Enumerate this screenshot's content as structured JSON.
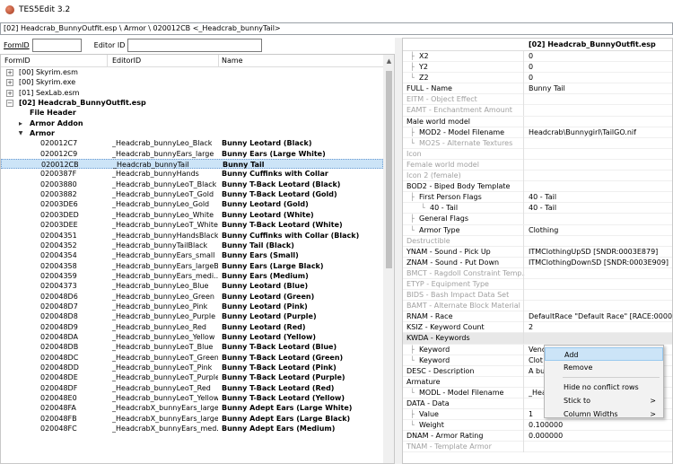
{
  "window": {
    "title": "TES5Edit 3.2"
  },
  "path": "[02] Headcrab_BunnyOutfit.esp \\ Armor \\ 020012CB <_Headcrab_bunnyTail>",
  "filter": {
    "formid_label": "FormID",
    "editorid_label": "Editor ID"
  },
  "left": {
    "columns": [
      "FormID",
      "EditorID",
      "Name"
    ],
    "top": [
      {
        "label": "[00] Skyrim.esm",
        "exp": "+"
      },
      {
        "label": "[00] Skyrim.exe",
        "exp": "+"
      },
      {
        "label": "[01] SexLab.esm",
        "exp": "+"
      },
      {
        "label": "[02] Headcrab_BunnyOutfit.esp",
        "exp": "-"
      },
      {
        "label": "File Header",
        "exp": ""
      },
      {
        "label": "Armor Addon",
        "exp": "+"
      },
      {
        "label": "Armor",
        "exp": "-"
      }
    ],
    "rows": [
      [
        "020012C7",
        "_Headcrab_bunnyLeo_Black",
        "Bunny Leotard (Black)"
      ],
      [
        "020012C9",
        "_Headcrab_bunnyEars_large",
        "Bunny Ears (Large White)"
      ],
      [
        "020012CB",
        "_Headcrab_bunnyTail",
        "Bunny Tail"
      ],
      [
        "0200387F",
        "_Headcrab_bunnyHands",
        "Bunny Cuffinks with Collar"
      ],
      [
        "02003880",
        "_Headcrab_bunnyLeoT_Black",
        "Bunny T-Back Leotard (Black)"
      ],
      [
        "02003882",
        "_Headcrab_bunnyLeoT_Gold",
        "Bunny T-Back Leotard (Gold)"
      ],
      [
        "02003DE6",
        "_Headcrab_bunnyLeo_Gold",
        "Bunny Leotard (Gold)"
      ],
      [
        "02003DED",
        "_Headcrab_bunnyLeo_White",
        "Bunny Leotard (White)"
      ],
      [
        "02003DEE",
        "_Headcrab_bunnyLeoT_White",
        "Bunny T-Back Leotard (White)"
      ],
      [
        "02004351",
        "_Headcrab_bunnyHandsBlack",
        "Bunny Cuffinks with Collar (Black)"
      ],
      [
        "02004352",
        "_Headcrab_bunnyTailBlack",
        "Bunny Tail (Black)"
      ],
      [
        "02004354",
        "_Headcrab_bunnyEars_small",
        "Bunny Ears (Small)"
      ],
      [
        "02004358",
        "_Headcrab_bunnyEars_largeB",
        "Bunny Ears (Large Black)"
      ],
      [
        "02004359",
        "_Headcrab_bunnyEars_medi...",
        "Bunny Ears (Medium)"
      ],
      [
        "02004373",
        "_Headcrab_bunnyLeo_Blue",
        "Bunny Leotard (Blue)"
      ],
      [
        "020048D6",
        "_Headcrab_bunnyLeo_Green",
        "Bunny Leotard (Green)"
      ],
      [
        "020048D7",
        "_Headcrab_bunnyLeo_Pink",
        "Bunny Leotard (Pink)"
      ],
      [
        "020048D8",
        "_Headcrab_bunnyLeo_Purple",
        "Bunny Leotard (Purple)"
      ],
      [
        "020048D9",
        "_Headcrab_bunnyLeo_Red",
        "Bunny Leotard (Red)"
      ],
      [
        "020048DA",
        "_Headcrab_bunnyLeo_Yellow",
        "Bunny Leotard (Yellow)"
      ],
      [
        "020048DB",
        "_Headcrab_bunnyLeoT_Blue",
        "Bunny T-Back Leotard (Blue)"
      ],
      [
        "020048DC",
        "_Headcrab_bunnyLeoT_Green",
        "Bunny T-Back Leotard (Green)"
      ],
      [
        "020048DD",
        "_Headcrab_bunnyLeoT_Pink",
        "Bunny T-Back Leotard (Pink)"
      ],
      [
        "020048DE",
        "_Headcrab_bunnyLeoT_Purple",
        "Bunny T-Back Leotard (Purple)"
      ],
      [
        "020048DF",
        "_Headcrab_bunnyLeoT_Red",
        "Bunny T-Back Leotard (Red)"
      ],
      [
        "020048E0",
        "_Headcrab_bunnyLeoT_Yellow",
        "Bunny T-Back Leotard (Yellow)"
      ],
      [
        "020048FA",
        "_HeadcrabX_bunnyEars_large",
        "Bunny Adept Ears (Large White)"
      ],
      [
        "020048FB",
        "_HeadcrabX_bunnyEars_large",
        "Bunny Adept Ears (Large Black)"
      ],
      [
        "020048FC",
        "_HeadcrabX_bunnyEars_med...",
        "Bunny Adept Ears (Medium)"
      ]
    ]
  },
  "right": {
    "header": "[02] Headcrab_BunnyOutfit.esp",
    "rows": [
      {
        "k": "X2",
        "v": "0",
        "ind": 18,
        "g": "├"
      },
      {
        "k": "Y2",
        "v": "0",
        "ind": 18,
        "g": "├"
      },
      {
        "k": "Z2",
        "v": "0",
        "ind": 18,
        "g": "└"
      },
      {
        "k": "FULL - Name",
        "v": "Bunny Tail",
        "ind": 4
      },
      {
        "k": "EITM - Object Effect",
        "v": "",
        "ind": 4,
        "gray": true
      },
      {
        "k": "EAMT - Enchantment Amount",
        "v": "",
        "ind": 4,
        "gray": true
      },
      {
        "k": "Male world model",
        "v": "",
        "ind": 4
      },
      {
        "k": "MOD2 - Model Filename",
        "v": "Headcrab\\Bunnygirl\\TailGO.nif",
        "ind": 18,
        "g": "├"
      },
      {
        "k": "MO2S - Alternate Textures",
        "v": "",
        "ind": 18,
        "g": "└",
        "gray": true
      },
      {
        "k": "Icon",
        "v": "",
        "ind": 4,
        "gray": true
      },
      {
        "k": "Female world model",
        "v": "",
        "ind": 4,
        "gray": true
      },
      {
        "k": "Icon 2 (female)",
        "v": "",
        "ind": 4,
        "gray": true
      },
      {
        "k": "BOD2 - Biped Body Template",
        "v": "",
        "ind": 4
      },
      {
        "k": "First Person Flags",
        "v": "40 - Tail",
        "ind": 18,
        "g": "├"
      },
      {
        "k": "40 - Tail",
        "v": "40 - Tail",
        "ind": 30,
        "g": "└"
      },
      {
        "k": "General Flags",
        "v": "",
        "ind": 18,
        "g": "├"
      },
      {
        "k": "Armor Type",
        "v": "Clothing",
        "ind": 18,
        "g": "└"
      },
      {
        "k": "Destructible",
        "v": "",
        "ind": 4,
        "gray": true
      },
      {
        "k": "YNAM - Sound - Pick Up",
        "v": "ITMClothingUpSD [SNDR:0003E879]",
        "ind": 4
      },
      {
        "k": "ZNAM - Sound - Put Down",
        "v": "ITMClothingDownSD [SNDR:0003E909]",
        "ind": 4
      },
      {
        "k": "BMCT - Ragdoll Constraint Temp...",
        "v": "",
        "ind": 4,
        "gray": true
      },
      {
        "k": "ETYP - Equipment Type",
        "v": "",
        "ind": 4,
        "gray": true
      },
      {
        "k": "BIDS - Bash Impact Data Set",
        "v": "",
        "ind": 4,
        "gray": true
      },
      {
        "k": "BAMT - Alternate Block Material",
        "v": "",
        "ind": 4,
        "gray": true
      },
      {
        "k": "RNAM - Race",
        "v": "DefaultRace \"Default Race\" [RACE:00000019]",
        "ind": 4
      },
      {
        "k": "KSIZ - Keyword Count",
        "v": "2",
        "ind": 4
      },
      {
        "k": "KWDA - Keywords",
        "v": "",
        "ind": 4,
        "hl": true
      },
      {
        "k": "Keyword",
        "v": "Vend",
        "ind": 18,
        "g": "├"
      },
      {
        "k": "Keyword",
        "v": "Clot",
        "ind": 18,
        "g": "└"
      },
      {
        "k": "DESC - Description",
        "v": "A bu",
        "ind": 4
      },
      {
        "k": "Armature",
        "v": "",
        "ind": 4
      },
      {
        "k": "MODL - Model Filename",
        "v": "_Hea",
        "ind": 18,
        "g": "└"
      },
      {
        "k": "DATA - Data",
        "v": "",
        "ind": 4
      },
      {
        "k": "Value",
        "v": "1",
        "ind": 18,
        "g": "├"
      },
      {
        "k": "Weight",
        "v": "0.100000",
        "ind": 18,
        "g": "└"
      },
      {
        "k": "DNAM - Armor Rating",
        "v": "0.000000",
        "ind": 4
      },
      {
        "k": "TNAM - Template Armor",
        "v": "",
        "ind": 4,
        "gray": true
      }
    ]
  },
  "context_menu": {
    "add": "Add",
    "remove": "Remove",
    "hide_conflict": "Hide no conflict rows",
    "stick_to": "Stick to",
    "column_widths": "Column Widths"
  }
}
